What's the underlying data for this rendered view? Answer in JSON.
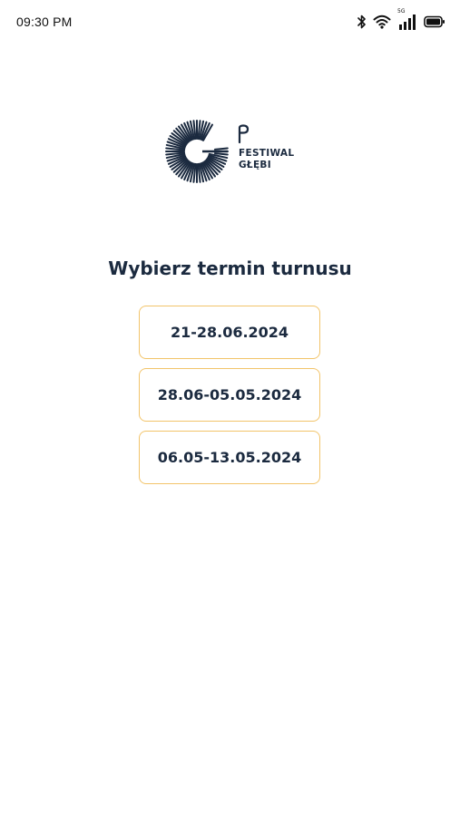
{
  "status_bar": {
    "time": "09:30 PM",
    "network_label": "5G",
    "icons": [
      "bluetooth-icon",
      "wifi-icon",
      "cellular-signal-icon",
      "battery-icon"
    ]
  },
  "logo": {
    "line1": "FESTIWAL",
    "line2": "GŁĘBI",
    "color": "#1b2a3f"
  },
  "page": {
    "title": "Wybierz termin turnusu"
  },
  "date_options": [
    {
      "label": "21-28.06.2024"
    },
    {
      "label": "28.06-05.05.2024"
    },
    {
      "label": "06.05-13.05.2024"
    }
  ],
  "colors": {
    "option_border": "#f2c46a",
    "text_primary": "#1b2a3f",
    "background": "#ffffff"
  }
}
